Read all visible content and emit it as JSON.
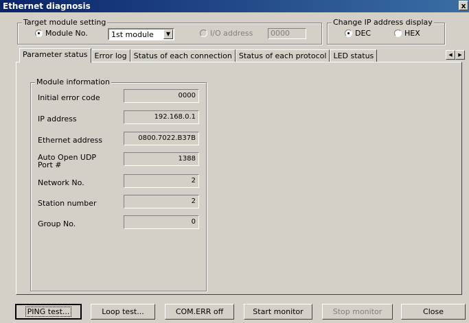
{
  "window": {
    "title": "Ethernet diagnosis",
    "close_glyph": "x"
  },
  "target_module": {
    "legend": "Target module setting",
    "module_no_label": "Module No.",
    "module_no_value": "1st module",
    "io_address_label": "I/O address",
    "io_address_value": "0000"
  },
  "ip_display": {
    "legend": "Change IP address display",
    "dec_label": "DEC",
    "hex_label": "HEX",
    "selected": "DEC"
  },
  "tabs": [
    {
      "label": "Parameter status",
      "active": true
    },
    {
      "label": "Error log"
    },
    {
      "label": "Status of each connection"
    },
    {
      "label": "Status of each protocol"
    },
    {
      "label": "LED status"
    }
  ],
  "module_info": {
    "legend": "Module information",
    "fields": [
      {
        "label": "Initial error code",
        "value": "0000"
      },
      {
        "label": "IP address",
        "value": "192.168.0.1"
      },
      {
        "label": "Ethernet address",
        "value": "0800.7022.B37B"
      },
      {
        "label": "Auto Open UDP\nPort #",
        "value": "1388"
      },
      {
        "label": "Network No.",
        "value": "2"
      },
      {
        "label": "Station number",
        "value": "2"
      },
      {
        "label": "Group No.",
        "value": "0"
      }
    ]
  },
  "buttons": {
    "ping": "PING test...",
    "loop": "Loop test...",
    "comerr": "COM.ERR off",
    "start": "Start monitor",
    "stop": "Stop monitor",
    "close": "Close"
  }
}
